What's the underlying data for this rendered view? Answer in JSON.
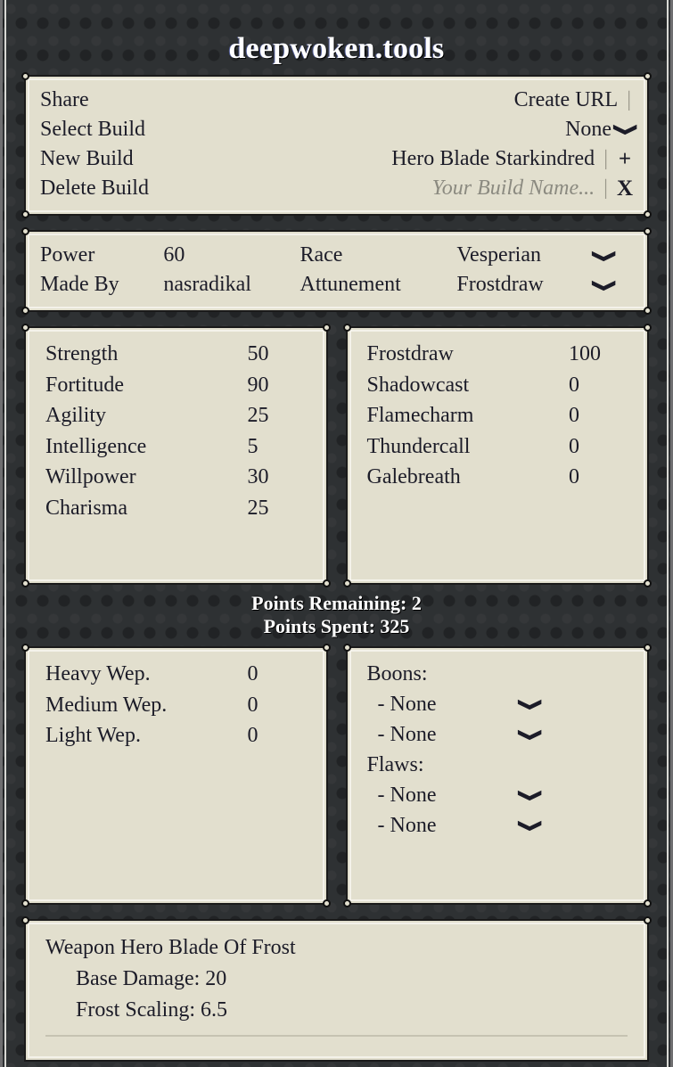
{
  "site": {
    "title": "deepwoken.tools"
  },
  "share": {
    "rows": [
      {
        "label": "Share",
        "value": "Create URL",
        "sep": "|",
        "btn": "",
        "chevron": ""
      },
      {
        "label": "Select Build",
        "value": "None",
        "sep": "",
        "btn": "",
        "chevron": "chevron-down-icon"
      },
      {
        "label": "New Build",
        "value": "Hero Blade Starkindred",
        "sep": "|",
        "btn": "+",
        "chevron": ""
      },
      {
        "label": "Delete Build",
        "value": "",
        "sep": "|",
        "btn": "X",
        "chevron": ""
      }
    ],
    "build_name_placeholder": "Your Build Name..."
  },
  "info": {
    "rows": [
      {
        "label": "Power",
        "value": "60",
        "label2": "Race",
        "value2": "Vesperian",
        "chevron": "chevron-down-icon"
      },
      {
        "label": "Made By",
        "value": "nasradikal",
        "label2": "Attunement",
        "value2": "Frostdraw",
        "chevron": "chevron-down-icon"
      }
    ]
  },
  "stats": {
    "attributes": [
      {
        "name": "Strength",
        "value": "50"
      },
      {
        "name": "Fortitude",
        "value": "90"
      },
      {
        "name": "Agility",
        "value": "25"
      },
      {
        "name": "Intelligence",
        "value": "5"
      },
      {
        "name": "Willpower",
        "value": "30"
      },
      {
        "name": "Charisma",
        "value": "25"
      }
    ],
    "attunements": [
      {
        "name": "Frostdraw",
        "value": "100"
      },
      {
        "name": "Shadowcast",
        "value": "0"
      },
      {
        "name": "Flamecharm",
        "value": "0"
      },
      {
        "name": "Thundercall",
        "value": "0"
      },
      {
        "name": "Galebreath",
        "value": "0"
      }
    ]
  },
  "points": {
    "remaining": "Points Remaining: 2",
    "spent": "Points Spent: 325"
  },
  "weapons": [
    {
      "name": "Heavy Wep.",
      "value": "0"
    },
    {
      "name": "Medium Wep.",
      "value": "0"
    },
    {
      "name": "Light Wep.",
      "value": "0"
    }
  ],
  "boons_flaws": {
    "boons_label": "Boons:",
    "flaws_label": "Flaws:",
    "boons": [
      {
        "name": "- None",
        "chevron": "chevron-down-icon"
      },
      {
        "name": "- None",
        "chevron": "chevron-down-icon"
      }
    ],
    "flaws": [
      {
        "name": "- None",
        "chevron": "chevron-down-icon"
      },
      {
        "name": "- None",
        "chevron": "chevron-down-icon"
      }
    ]
  },
  "weapon_detail": {
    "title": "Weapon Hero Blade Of Frost",
    "base_damage": "Base Damage: 20",
    "frost_scaling": "Frost Scaling: 6.5"
  },
  "colors": {
    "page_bg": "#2e3133",
    "panel_bg": "#e2dfce",
    "text": "#1c1c28",
    "title_text": "#ffffff"
  }
}
